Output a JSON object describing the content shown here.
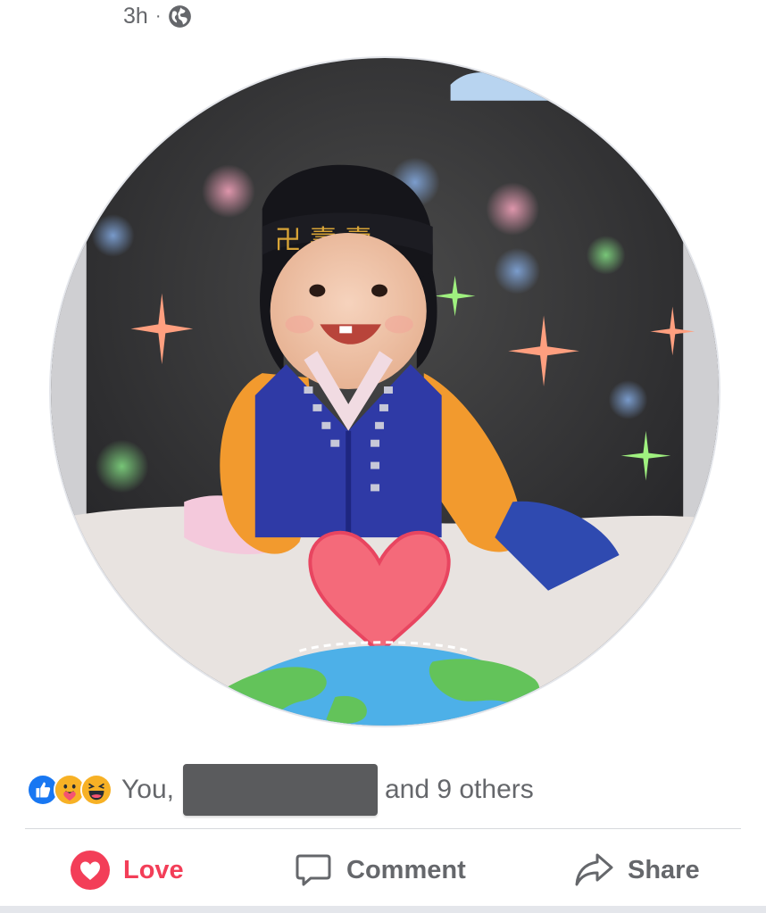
{
  "post": {
    "timestamp": "3h",
    "separator": "·",
    "privacy_icon": "globe-icon"
  },
  "photo": {
    "description_icon": "profile-photo"
  },
  "reactions": {
    "icons": [
      "like-icon",
      "care-icon",
      "haha-icon"
    ],
    "text_prefix": "You,",
    "text_suffix": "and 9 others"
  },
  "actions": {
    "love_label": "Love",
    "comment_label": "Comment",
    "share_label": "Share"
  },
  "colors": {
    "love": "#f33e58",
    "like": "#1877f2",
    "secondary_text": "#65676b"
  }
}
